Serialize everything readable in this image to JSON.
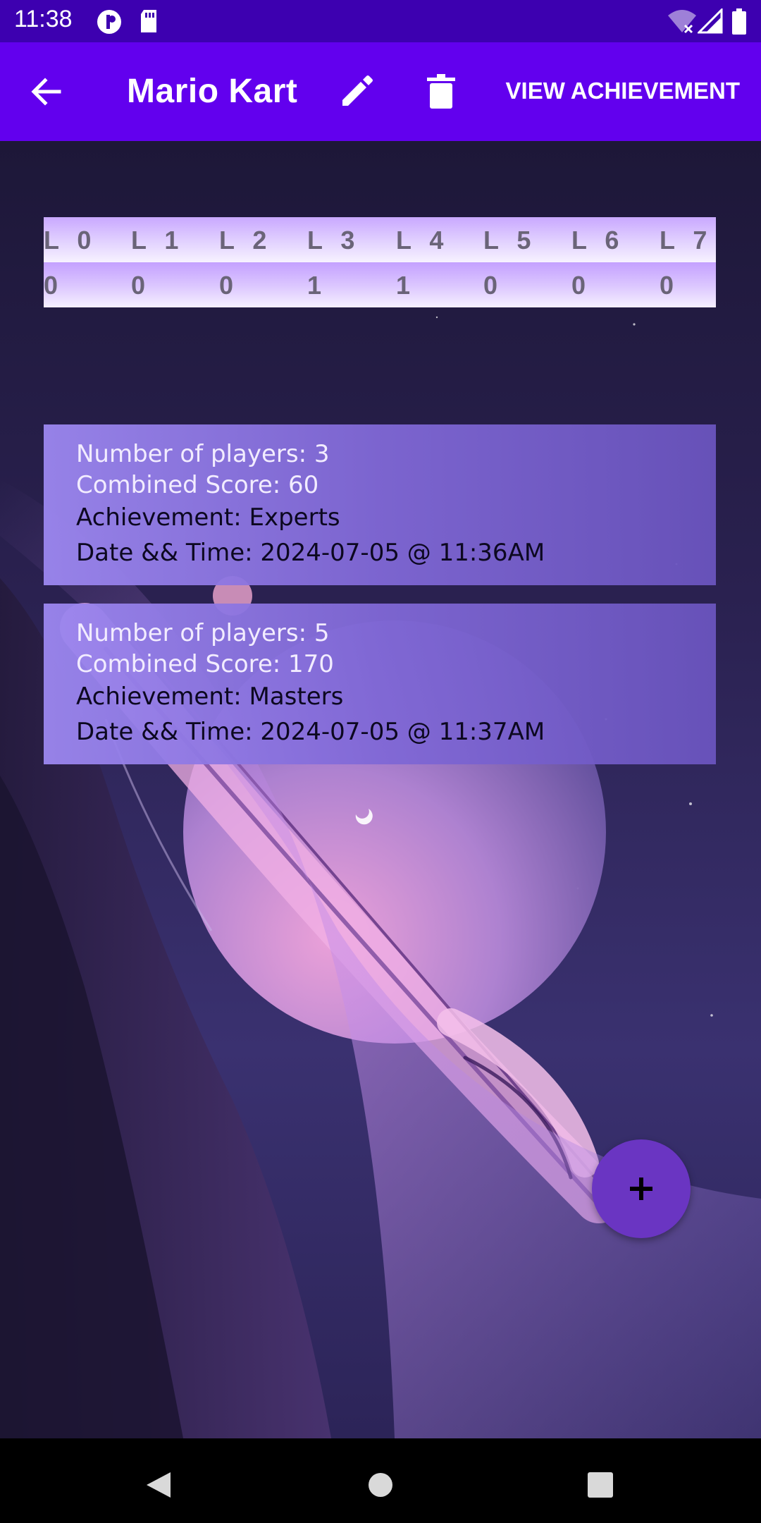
{
  "status_bar": {
    "time": "11:38",
    "icons": [
      "privacy-indicator-icon",
      "sd-card-icon",
      "wifi-off-icon",
      "cell-signal-icon",
      "battery-icon"
    ]
  },
  "app_bar": {
    "title": "Mario Kart",
    "view_achievement_label": "VIEW ACHIEVEMENT",
    "icons": [
      "back-arrow-icon",
      "pencil-icon",
      "trash-icon"
    ],
    "color": "#6200ee"
  },
  "level_table": {
    "headers": [
      "L 0",
      "L 1",
      "L 2",
      "L 3",
      "L 4",
      "L 5",
      "L 6",
      "L 7"
    ],
    "values": [
      "0",
      "0",
      "0",
      "1",
      "1",
      "0",
      "0",
      "0"
    ]
  },
  "sessions": [
    {
      "players": "Number of players: 3",
      "score": "Combined Score: 60",
      "achievement": "Achievement: Experts",
      "datetime": "Date && Time: 2024-07-05 @ 11:36AM"
    },
    {
      "players": "Number of players: 5",
      "score": "Combined Score: 170",
      "achievement": "Achievement: Masters",
      "datetime": "Date && Time: 2024-07-05 @ 11:37AM"
    }
  ],
  "fab": {
    "icon": "plus-icon",
    "color": "#6a35c2"
  },
  "nav_bar": {
    "icons": [
      "nav-back-icon",
      "nav-home-icon",
      "nav-recents-icon"
    ]
  }
}
